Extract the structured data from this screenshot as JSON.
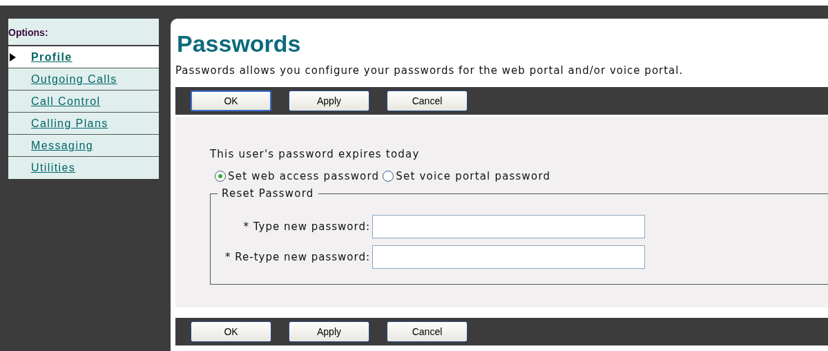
{
  "sidebar": {
    "title": "Options:",
    "items": [
      {
        "label": "Profile",
        "selected": true
      },
      {
        "label": "Outgoing Calls",
        "selected": false
      },
      {
        "label": "Call Control",
        "selected": false
      },
      {
        "label": "Calling Plans",
        "selected": false
      },
      {
        "label": "Messaging",
        "selected": false
      },
      {
        "label": "Utilities",
        "selected": false
      }
    ]
  },
  "page": {
    "title": "Passwords",
    "description": "Passwords allows you configure your passwords for the web portal and/or voice portal."
  },
  "top_buttons": [
    "OK",
    "Apply",
    "Cancel"
  ],
  "form": {
    "notice": "This user's password expires today",
    "radios": [
      {
        "label": "Set web access password",
        "selected": true
      },
      {
        "label": "Set voice portal password",
        "selected": false
      }
    ],
    "fieldset": {
      "legend": "Reset Password",
      "fields": [
        {
          "label": "* Type new password:"
        },
        {
          "label": "* Re-type new password:"
        }
      ]
    }
  },
  "bottom_buttons": [
    "OK",
    "Apply",
    "Cancel"
  ]
}
